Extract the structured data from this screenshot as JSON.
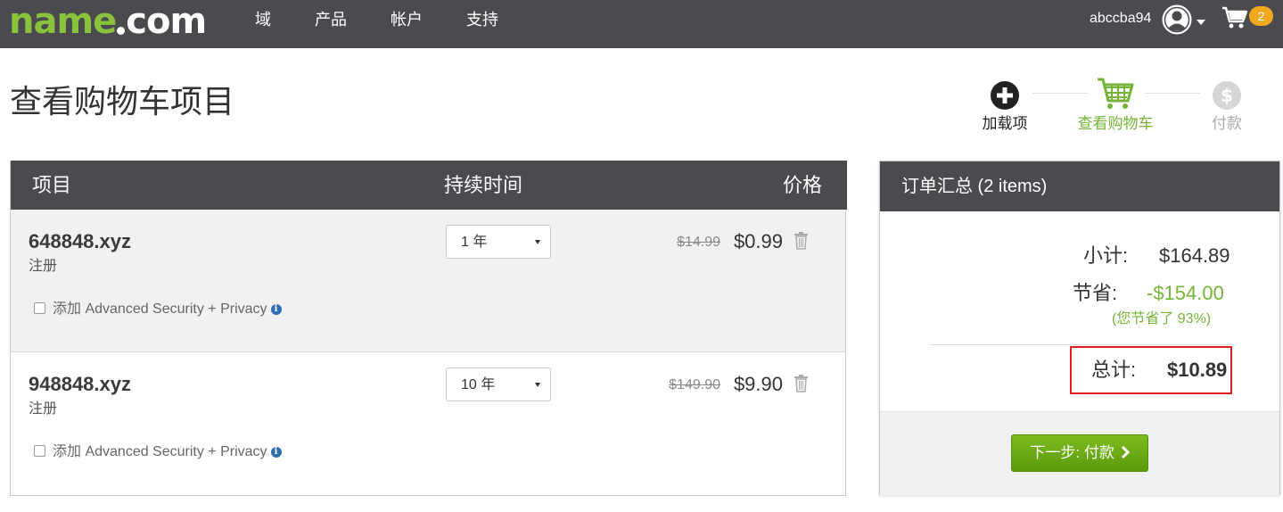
{
  "brand": {
    "logo_main": "name",
    "logo_domain": "com",
    "accent_green": "#8ac33b",
    "nav_bg": "#4a4a4f",
    "badge_orange": "#f0a81d"
  },
  "nav": {
    "items": [
      "域",
      "产品",
      "帐户",
      "支持"
    ],
    "username": "abccba94",
    "cart_count": "2"
  },
  "page": {
    "title": "查看购物车项目"
  },
  "steps": [
    {
      "label": "加载项",
      "icon": "plus-circle-icon",
      "state": "done"
    },
    {
      "label": "查看购物车",
      "icon": "shopping-cart-icon",
      "state": "active"
    },
    {
      "label": "付款",
      "icon": "dollar-circle-icon",
      "state": "pending"
    }
  ],
  "table": {
    "headers": {
      "item": "项目",
      "duration": "持续时间",
      "price": "价格"
    },
    "rows": [
      {
        "domain": "648848.xyz",
        "type": "注册",
        "addon": "添加 Advanced Security + Privacy",
        "duration": "1 年",
        "old_price": "$14.99",
        "price": "$0.99"
      },
      {
        "domain": "948848.xyz",
        "type": "注册",
        "addon": "添加 Advanced Security + Privacy",
        "duration": "10 年",
        "old_price": "$149.90",
        "price": "$9.90"
      }
    ]
  },
  "summary": {
    "title": "订单汇总 (2 items)",
    "subtotal_label": "小计:",
    "subtotal": "$164.89",
    "savings_label": "节省:",
    "savings": "-$154.00",
    "savings_note": "(您节省了 93%)",
    "total_label": "总计:",
    "total": "$10.89",
    "next_button": "下一步: 付款",
    "savings_color": "#75b437",
    "highlight_color": "#e02020"
  }
}
